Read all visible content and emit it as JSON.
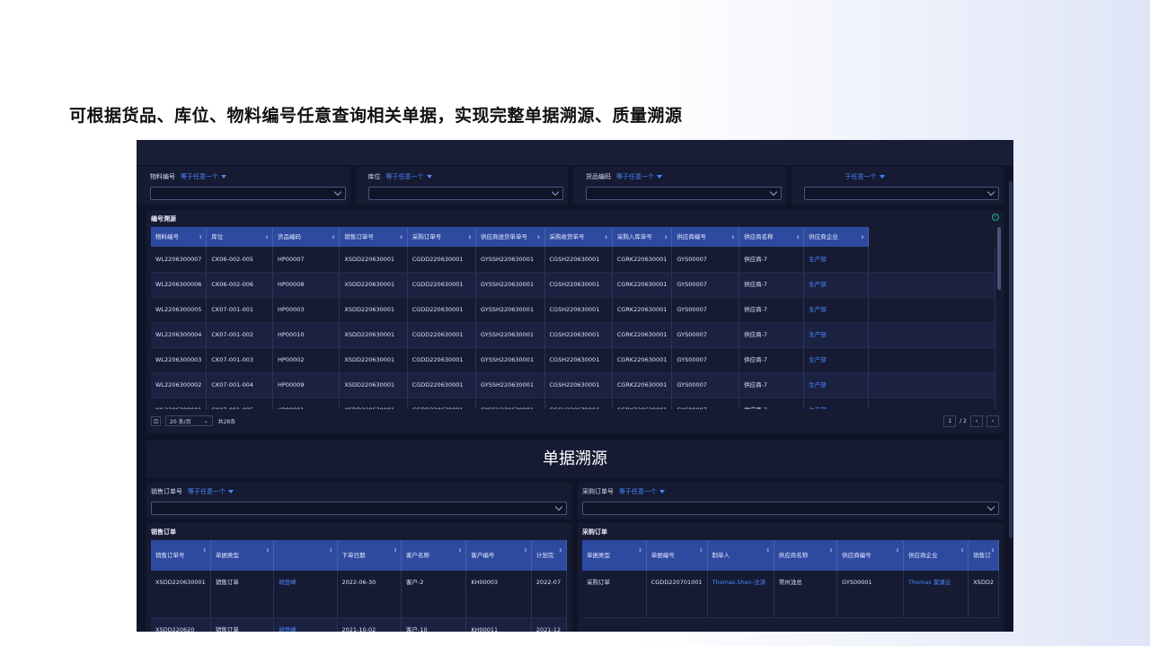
{
  "headline": "可根据货品、库位、物料编号任意查询相关单据，实现完整单据溯源、质量溯源",
  "filters": [
    {
      "label": "物料编号",
      "op": "等于任意一个"
    },
    {
      "label": "库位",
      "op": "等于任意一个"
    },
    {
      "label": "货品编码",
      "op": "等于任意一个"
    },
    {
      "label": "",
      "op": "于任意一个"
    }
  ],
  "trace_table": {
    "title": "编号溯源",
    "columns": [
      "物料编号",
      "库位",
      "货品编码",
      "销售订单号",
      "采购订单号",
      "供应商送货单单号",
      "采购收货单号",
      "采购入库单号",
      "供应商编号",
      "供应商名称",
      "供应商企业"
    ],
    "rows": [
      [
        "WL2206300007",
        "CK06-002-005",
        "HP00007",
        "XSDD220630001",
        "CGDD220630001",
        "GYSSH220630001",
        "CGSH220630001",
        "CGRK220630001",
        "GYS00007",
        "供应商-7",
        "生产部"
      ],
      [
        "WL2206300006",
        "CK06-002-006",
        "HP00008",
        "XSDD220630001",
        "CGDD220630001",
        "GYSSH220630001",
        "CGSH220630001",
        "CGRK220630001",
        "GYS00007",
        "供应商-7",
        "生产部"
      ],
      [
        "WL2206300005",
        "CK07-001-001",
        "HP00003",
        "XSDD220630001",
        "CGDD220630001",
        "GYSSH220630001",
        "CGSH220630001",
        "CGRK220630001",
        "GYS00007",
        "供应商-7",
        "生产部"
      ],
      [
        "WL2206300004",
        "CK07-001-002",
        "HP00010",
        "XSDD220630001",
        "CGDD220630001",
        "GYSSH220630001",
        "CGSH220630001",
        "CGRK220630001",
        "GYS00007",
        "供应商-7",
        "生产部"
      ],
      [
        "WL2206300003",
        "CK07-001-003",
        "HP00002",
        "XSDD220630001",
        "CGDD220630001",
        "GYSSH220630001",
        "CGSH220630001",
        "CGRK220630001",
        "GYS00007",
        "供应商-7",
        "生产部"
      ],
      [
        "WL2206300002",
        "CK07-001-004",
        "HP00009",
        "XSDD220630001",
        "CGDD220630001",
        "GYSSH220630001",
        "CGSH220630001",
        "CGRK220630001",
        "GYS00007",
        "供应商-7",
        "生产部"
      ],
      [
        "WL2206300001",
        "CK07-001-005",
        "HP00001",
        "XSDD220630001",
        "CGDD220630001",
        "GYSSH220630001",
        "CGSH220630001",
        "CGRK220630001",
        "GYS00007",
        "供应商-7",
        "生产部"
      ]
    ],
    "pager": {
      "page_size": "20 条/页",
      "total": "共28条",
      "current": "1",
      "pages": "/ 2"
    }
  },
  "section_title": "单据溯源",
  "sales": {
    "filter_label": "销售订单号",
    "filter_op": "等于任意一个",
    "title": "销售订单",
    "columns": [
      "销售订单号",
      "单据类型",
      "",
      "下单日期",
      "客户名称",
      "客户编号",
      "计划完"
    ],
    "rows": [
      [
        "XSDD220630001",
        "销售订单",
        "胡登峰",
        "2022-06-30",
        "客户-2",
        "KH00003",
        "2022-07"
      ],
      [
        "XSDD220620",
        "销售订单",
        "胡登峰",
        "2021-10-02",
        "客户-10",
        "KH00011",
        "2021-12"
      ]
    ]
  },
  "purchase": {
    "filter_label": "采购订单号",
    "filter_op": "等于任意一个",
    "title": "采购订单",
    "columns": [
      "单据类型",
      "单据编号",
      "制单人",
      "供应商名称",
      "供应商编号",
      "供应商企业",
      "销售订"
    ],
    "rows": [
      [
        "采购订单",
        "CGDD220701001",
        "Thomas.Shen-沈涛",
        "常州泷总",
        "GYS00001",
        "Thomas 莫谦云",
        "XSDD2"
      ]
    ]
  }
}
